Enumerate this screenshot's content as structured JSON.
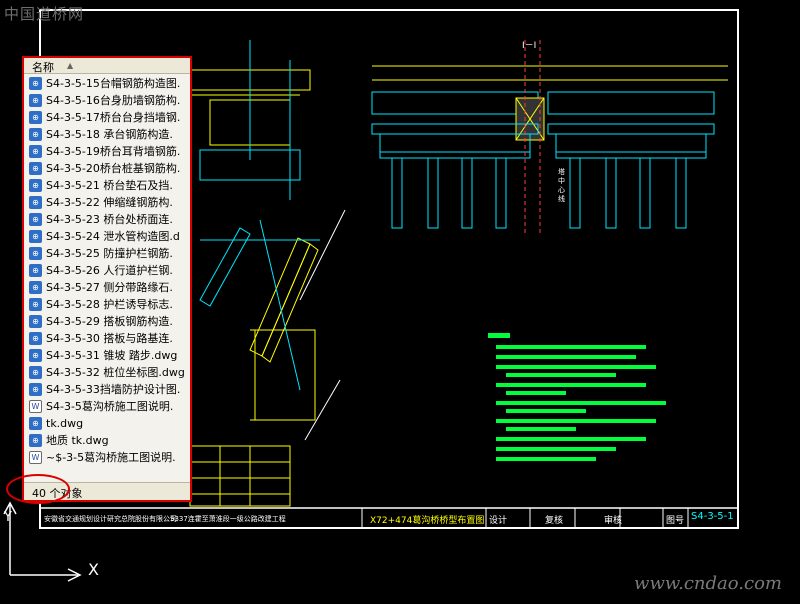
{
  "watermark": {
    "top": "中国道桥网",
    "bottom": "www.cndao.com"
  },
  "drawing": {
    "section_title": "I－I",
    "tower_labels": [
      "塔中心线"
    ],
    "sheet_title": "X72+474葛沟桥桥型布置图",
    "company": "安徽省交通规划设计研究总院股份有限公司",
    "project": "S337连霍至萧淮段一级公路改建工程",
    "design_label": "设计",
    "review_label": "复核",
    "check_label": "审核",
    "drawing_no_label": "图号",
    "drawing_no": "S4-3-5-1"
  },
  "file_panel": {
    "header_label": "名称",
    "status_text": "40 个对象",
    "items": [
      {
        "icon": "dwg",
        "name": "S4-3-5-15台帽钢筋构造图."
      },
      {
        "icon": "dwg",
        "name": "S4-3-5-16台身肋墙钢筋构."
      },
      {
        "icon": "dwg",
        "name": "S4-3-5-17桥台台身挡墙钢."
      },
      {
        "icon": "dwg",
        "name": "S4-3-5-18 承台钢筋构造."
      },
      {
        "icon": "dwg",
        "name": "S4-3-5-19桥台耳背墙钢筋."
      },
      {
        "icon": "dwg",
        "name": "S4-3-5-20桥台桩基钢筋构."
      },
      {
        "icon": "dwg",
        "name": "S4-3-5-21 桥台垫石及挡."
      },
      {
        "icon": "dwg",
        "name": "S4-3-5-22 伸缩缝钢筋构."
      },
      {
        "icon": "dwg",
        "name": "S4-3-5-23 桥台处桥面连."
      },
      {
        "icon": "dwg",
        "name": "S4-3-5-24 泄水管构造图.d"
      },
      {
        "icon": "dwg",
        "name": "S4-3-5-25 防撞护栏钢筋."
      },
      {
        "icon": "dwg",
        "name": "S4-3-5-26 人行道护栏钢."
      },
      {
        "icon": "dwg",
        "name": "S4-3-5-27 侧分带路缘石."
      },
      {
        "icon": "dwg",
        "name": "S4-3-5-28 护栏诱导标志."
      },
      {
        "icon": "dwg",
        "name": "S4-3-5-29 搭板钢筋构造."
      },
      {
        "icon": "dwg",
        "name": "S4-3-5-30 搭板与路基连."
      },
      {
        "icon": "dwg",
        "name": "S4-3-5-31 锥坡 踏步.dwg"
      },
      {
        "icon": "dwg",
        "name": "S4-3-5-32 桩位坐标图.dwg"
      },
      {
        "icon": "dwg",
        "name": "S4-3-5-33挡墙防护设计图."
      },
      {
        "icon": "doc",
        "name": "S4-3-5葛沟桥施工图说明."
      },
      {
        "icon": "dwg",
        "name": "tk.dwg"
      },
      {
        "icon": "dwg",
        "name": "地质 tk.dwg"
      },
      {
        "icon": "doc",
        "name": "~$-3-5葛沟桥施工图说明."
      }
    ]
  },
  "axis": {
    "x": "X",
    "y": "Y"
  },
  "colors": {
    "panel_border": "#d90000",
    "cad_background": "#000000",
    "drawing_yellow": "#ffff00",
    "drawing_cyan": "#00e5ff",
    "drawing_green": "#00ff3a"
  }
}
